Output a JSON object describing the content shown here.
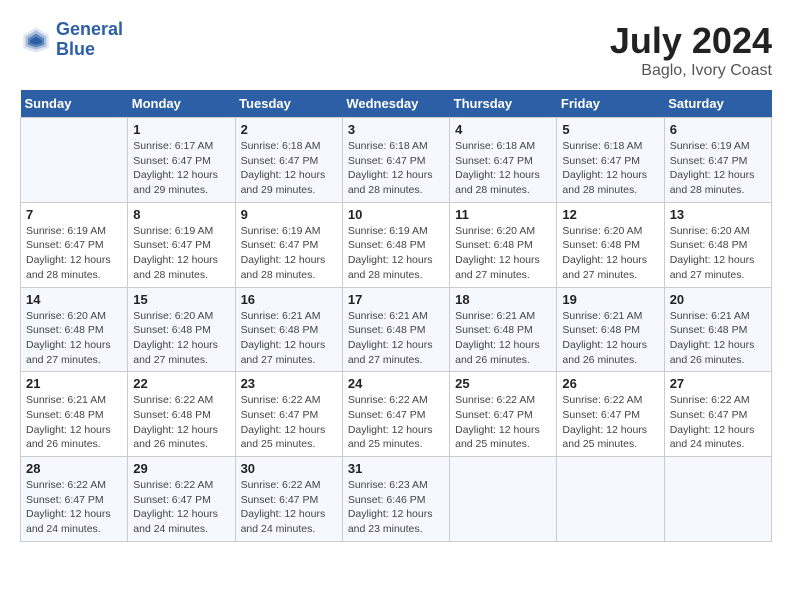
{
  "header": {
    "logo_line1": "General",
    "logo_line2": "Blue",
    "month": "July 2024",
    "location": "Baglo, Ivory Coast"
  },
  "weekdays": [
    "Sunday",
    "Monday",
    "Tuesday",
    "Wednesday",
    "Thursday",
    "Friday",
    "Saturday"
  ],
  "weeks": [
    [
      {
        "day": "",
        "info": ""
      },
      {
        "day": "1",
        "info": "Sunrise: 6:17 AM\nSunset: 6:47 PM\nDaylight: 12 hours\nand 29 minutes."
      },
      {
        "day": "2",
        "info": "Sunrise: 6:18 AM\nSunset: 6:47 PM\nDaylight: 12 hours\nand 29 minutes."
      },
      {
        "day": "3",
        "info": "Sunrise: 6:18 AM\nSunset: 6:47 PM\nDaylight: 12 hours\nand 28 minutes."
      },
      {
        "day": "4",
        "info": "Sunrise: 6:18 AM\nSunset: 6:47 PM\nDaylight: 12 hours\nand 28 minutes."
      },
      {
        "day": "5",
        "info": "Sunrise: 6:18 AM\nSunset: 6:47 PM\nDaylight: 12 hours\nand 28 minutes."
      },
      {
        "day": "6",
        "info": "Sunrise: 6:19 AM\nSunset: 6:47 PM\nDaylight: 12 hours\nand 28 minutes."
      }
    ],
    [
      {
        "day": "7",
        "info": "Sunrise: 6:19 AM\nSunset: 6:47 PM\nDaylight: 12 hours\nand 28 minutes."
      },
      {
        "day": "8",
        "info": "Sunrise: 6:19 AM\nSunset: 6:47 PM\nDaylight: 12 hours\nand 28 minutes."
      },
      {
        "day": "9",
        "info": "Sunrise: 6:19 AM\nSunset: 6:47 PM\nDaylight: 12 hours\nand 28 minutes."
      },
      {
        "day": "10",
        "info": "Sunrise: 6:19 AM\nSunset: 6:48 PM\nDaylight: 12 hours\nand 28 minutes."
      },
      {
        "day": "11",
        "info": "Sunrise: 6:20 AM\nSunset: 6:48 PM\nDaylight: 12 hours\nand 27 minutes."
      },
      {
        "day": "12",
        "info": "Sunrise: 6:20 AM\nSunset: 6:48 PM\nDaylight: 12 hours\nand 27 minutes."
      },
      {
        "day": "13",
        "info": "Sunrise: 6:20 AM\nSunset: 6:48 PM\nDaylight: 12 hours\nand 27 minutes."
      }
    ],
    [
      {
        "day": "14",
        "info": "Sunrise: 6:20 AM\nSunset: 6:48 PM\nDaylight: 12 hours\nand 27 minutes."
      },
      {
        "day": "15",
        "info": "Sunrise: 6:20 AM\nSunset: 6:48 PM\nDaylight: 12 hours\nand 27 minutes."
      },
      {
        "day": "16",
        "info": "Sunrise: 6:21 AM\nSunset: 6:48 PM\nDaylight: 12 hours\nand 27 minutes."
      },
      {
        "day": "17",
        "info": "Sunrise: 6:21 AM\nSunset: 6:48 PM\nDaylight: 12 hours\nand 27 minutes."
      },
      {
        "day": "18",
        "info": "Sunrise: 6:21 AM\nSunset: 6:48 PM\nDaylight: 12 hours\nand 26 minutes."
      },
      {
        "day": "19",
        "info": "Sunrise: 6:21 AM\nSunset: 6:48 PM\nDaylight: 12 hours\nand 26 minutes."
      },
      {
        "day": "20",
        "info": "Sunrise: 6:21 AM\nSunset: 6:48 PM\nDaylight: 12 hours\nand 26 minutes."
      }
    ],
    [
      {
        "day": "21",
        "info": "Sunrise: 6:21 AM\nSunset: 6:48 PM\nDaylight: 12 hours\nand 26 minutes."
      },
      {
        "day": "22",
        "info": "Sunrise: 6:22 AM\nSunset: 6:48 PM\nDaylight: 12 hours\nand 26 minutes."
      },
      {
        "day": "23",
        "info": "Sunrise: 6:22 AM\nSunset: 6:47 PM\nDaylight: 12 hours\nand 25 minutes."
      },
      {
        "day": "24",
        "info": "Sunrise: 6:22 AM\nSunset: 6:47 PM\nDaylight: 12 hours\nand 25 minutes."
      },
      {
        "day": "25",
        "info": "Sunrise: 6:22 AM\nSunset: 6:47 PM\nDaylight: 12 hours\nand 25 minutes."
      },
      {
        "day": "26",
        "info": "Sunrise: 6:22 AM\nSunset: 6:47 PM\nDaylight: 12 hours\nand 25 minutes."
      },
      {
        "day": "27",
        "info": "Sunrise: 6:22 AM\nSunset: 6:47 PM\nDaylight: 12 hours\nand 24 minutes."
      }
    ],
    [
      {
        "day": "28",
        "info": "Sunrise: 6:22 AM\nSunset: 6:47 PM\nDaylight: 12 hours\nand 24 minutes."
      },
      {
        "day": "29",
        "info": "Sunrise: 6:22 AM\nSunset: 6:47 PM\nDaylight: 12 hours\nand 24 minutes."
      },
      {
        "day": "30",
        "info": "Sunrise: 6:22 AM\nSunset: 6:47 PM\nDaylight: 12 hours\nand 24 minutes."
      },
      {
        "day": "31",
        "info": "Sunrise: 6:23 AM\nSunset: 6:46 PM\nDaylight: 12 hours\nand 23 minutes."
      },
      {
        "day": "",
        "info": ""
      },
      {
        "day": "",
        "info": ""
      },
      {
        "day": "",
        "info": ""
      }
    ]
  ]
}
